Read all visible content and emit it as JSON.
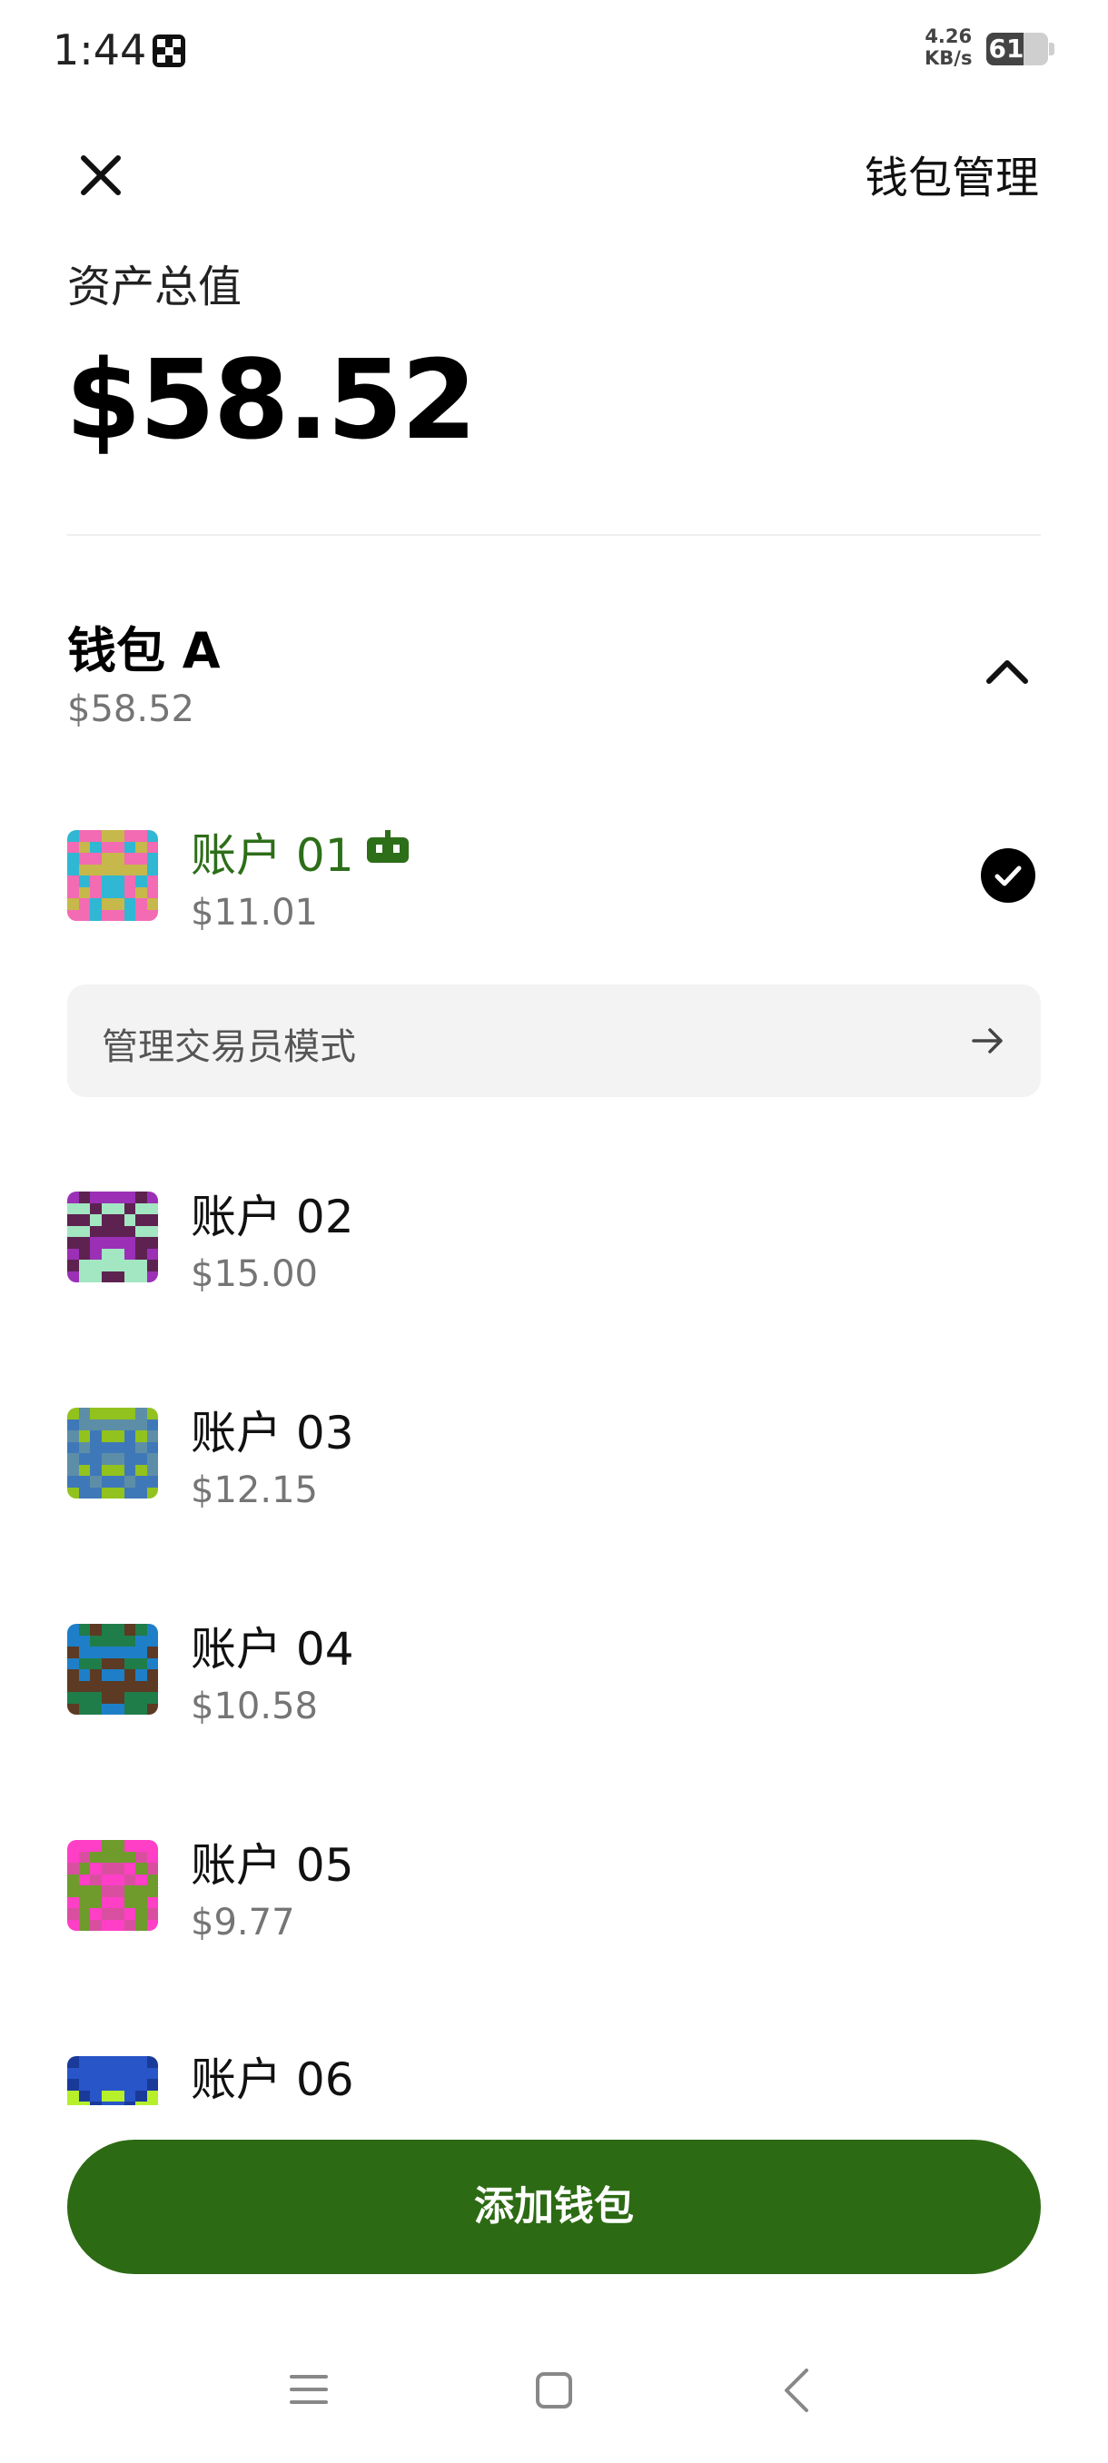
{
  "status_bar": {
    "time": "1:44",
    "net_speed_value": "4.26",
    "net_speed_unit": "KB/s",
    "battery_level": "61"
  },
  "header": {
    "close_icon": "close-icon",
    "title": "钱包管理"
  },
  "summary": {
    "label": "资产总值",
    "value": "$58.52"
  },
  "wallet": {
    "name": "钱包 A",
    "balance": "$58.52",
    "expanded": true,
    "accounts": [
      {
        "name": "账户 01",
        "balance": "$11.01",
        "active": true,
        "badge_icon": "robot-icon",
        "selected": true
      },
      {
        "name": "账户 02",
        "balance": "$15.00"
      },
      {
        "name": "账户 03",
        "balance": "$12.15"
      },
      {
        "name": "账户 04",
        "balance": "$10.58"
      },
      {
        "name": "账户 05",
        "balance": "$9.77"
      },
      {
        "name": "账户 06",
        "balance": ""
      }
    ],
    "trader_mode_label": "管理交易员模式"
  },
  "actions": {
    "add_wallet_label": "添加钱包"
  },
  "colors": {
    "accent_green": "#2d6a14",
    "active_text_green": "#2d6e19",
    "secondary_text": "#757575"
  }
}
